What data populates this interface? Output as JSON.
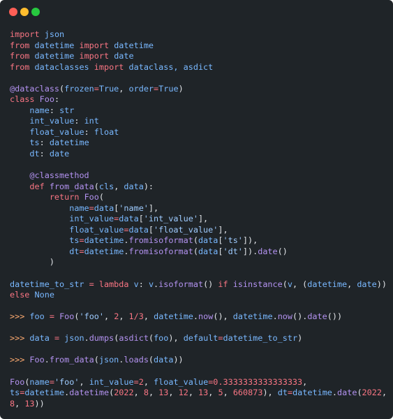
{
  "window": {
    "buttons": [
      "close",
      "minimize",
      "maximize"
    ],
    "colors": {
      "close": "#ff5f56",
      "minimize": "#ffbd2e",
      "maximize": "#27c93f",
      "background": "#1f2428"
    }
  },
  "code_lines": [
    [
      [
        "kw",
        "import"
      ],
      [
        "plain",
        " "
      ],
      [
        "mod",
        "json"
      ]
    ],
    [
      [
        "kw",
        "from"
      ],
      [
        "plain",
        " "
      ],
      [
        "mod",
        "datetime"
      ],
      [
        "plain",
        " "
      ],
      [
        "kw",
        "import"
      ],
      [
        "plain",
        " "
      ],
      [
        "mod",
        "datetime"
      ]
    ],
    [
      [
        "kw",
        "from"
      ],
      [
        "plain",
        " "
      ],
      [
        "mod",
        "datetime"
      ],
      [
        "plain",
        " "
      ],
      [
        "kw",
        "import"
      ],
      [
        "plain",
        " "
      ],
      [
        "mod",
        "date"
      ]
    ],
    [
      [
        "kw",
        "from"
      ],
      [
        "plain",
        " "
      ],
      [
        "mod",
        "dataclasses"
      ],
      [
        "plain",
        " "
      ],
      [
        "kw",
        "import"
      ],
      [
        "plain",
        " "
      ],
      [
        "mod",
        "dataclass, asdict"
      ]
    ],
    [],
    [
      [
        "fn",
        "@dataclass"
      ],
      [
        "plain",
        "("
      ],
      [
        "mod",
        "frozen"
      ],
      [
        "kw",
        "="
      ],
      [
        "mod",
        "True"
      ],
      [
        "plain",
        ", "
      ],
      [
        "mod",
        "order"
      ],
      [
        "kw",
        "="
      ],
      [
        "mod",
        "True"
      ],
      [
        "plain",
        ")"
      ]
    ],
    [
      [
        "kw",
        "class"
      ],
      [
        "plain",
        " "
      ],
      [
        "cls",
        "Foo"
      ],
      [
        "plain",
        ":"
      ]
    ],
    [
      [
        "plain",
        "    "
      ],
      [
        "mod",
        "name"
      ],
      [
        "plain",
        ": "
      ],
      [
        "mod",
        "str"
      ]
    ],
    [
      [
        "plain",
        "    "
      ],
      [
        "mod",
        "int_value"
      ],
      [
        "plain",
        ": "
      ],
      [
        "mod",
        "int"
      ]
    ],
    [
      [
        "plain",
        "    "
      ],
      [
        "mod",
        "float_value"
      ],
      [
        "plain",
        ": "
      ],
      [
        "mod",
        "float"
      ]
    ],
    [
      [
        "plain",
        "    "
      ],
      [
        "mod",
        "ts"
      ],
      [
        "plain",
        ": "
      ],
      [
        "mod",
        "datetime"
      ]
    ],
    [
      [
        "plain",
        "    "
      ],
      [
        "mod",
        "dt"
      ],
      [
        "plain",
        ": "
      ],
      [
        "mod",
        "date"
      ]
    ],
    [],
    [
      [
        "plain",
        "    "
      ],
      [
        "fn",
        "@classmethod"
      ]
    ],
    [
      [
        "plain",
        "    "
      ],
      [
        "kw",
        "def"
      ],
      [
        "plain",
        " "
      ],
      [
        "fn",
        "from_data"
      ],
      [
        "plain",
        "("
      ],
      [
        "mod",
        "cls"
      ],
      [
        "plain",
        ", "
      ],
      [
        "mod",
        "data"
      ],
      [
        "plain",
        "):"
      ]
    ],
    [
      [
        "plain",
        "        "
      ],
      [
        "kw",
        "return"
      ],
      [
        "plain",
        " "
      ],
      [
        "cls",
        "Foo"
      ],
      [
        "plain",
        "("
      ]
    ],
    [
      [
        "plain",
        "            "
      ],
      [
        "mod",
        "name"
      ],
      [
        "kw",
        "="
      ],
      [
        "mod",
        "data"
      ],
      [
        "plain",
        "["
      ],
      [
        "str",
        "'name'"
      ],
      [
        "plain",
        "],"
      ]
    ],
    [
      [
        "plain",
        "            "
      ],
      [
        "mod",
        "int_value"
      ],
      [
        "kw",
        "="
      ],
      [
        "mod",
        "data"
      ],
      [
        "plain",
        "["
      ],
      [
        "str",
        "'int_value'"
      ],
      [
        "plain",
        "],"
      ]
    ],
    [
      [
        "plain",
        "            "
      ],
      [
        "mod",
        "float_value"
      ],
      [
        "kw",
        "="
      ],
      [
        "mod",
        "data"
      ],
      [
        "plain",
        "["
      ],
      [
        "str",
        "'float_value'"
      ],
      [
        "plain",
        "],"
      ]
    ],
    [
      [
        "plain",
        "            "
      ],
      [
        "mod",
        "ts"
      ],
      [
        "kw",
        "="
      ],
      [
        "mod",
        "datetime"
      ],
      [
        "plain",
        "."
      ],
      [
        "fn",
        "fromisoformat"
      ],
      [
        "plain",
        "("
      ],
      [
        "mod",
        "data"
      ],
      [
        "plain",
        "["
      ],
      [
        "str",
        "'ts'"
      ],
      [
        "plain",
        "]),"
      ]
    ],
    [
      [
        "plain",
        "            "
      ],
      [
        "mod",
        "dt"
      ],
      [
        "kw",
        "="
      ],
      [
        "mod",
        "datetime"
      ],
      [
        "plain",
        "."
      ],
      [
        "fn",
        "fromisoformat"
      ],
      [
        "plain",
        "("
      ],
      [
        "mod",
        "data"
      ],
      [
        "plain",
        "["
      ],
      [
        "str",
        "'dt'"
      ],
      [
        "plain",
        "])."
      ],
      [
        "fn",
        "date"
      ],
      [
        "plain",
        "()"
      ]
    ],
    [
      [
        "plain",
        "        )"
      ]
    ],
    [],
    [
      [
        "mod",
        "datetime_to_str"
      ],
      [
        "plain",
        " "
      ],
      [
        "kw",
        "="
      ],
      [
        "plain",
        " "
      ],
      [
        "kw",
        "lambda"
      ],
      [
        "plain",
        " "
      ],
      [
        "mod",
        "v"
      ],
      [
        "plain",
        ": "
      ],
      [
        "mod",
        "v"
      ],
      [
        "plain",
        "."
      ],
      [
        "fn",
        "isoformat"
      ],
      [
        "plain",
        "() "
      ],
      [
        "kw",
        "if"
      ],
      [
        "plain",
        " "
      ],
      [
        "fn",
        "isinstance"
      ],
      [
        "plain",
        "("
      ],
      [
        "mod",
        "v"
      ],
      [
        "plain",
        ", ("
      ],
      [
        "mod",
        "datetime"
      ],
      [
        "plain",
        ", "
      ],
      [
        "mod",
        "date"
      ],
      [
        "plain",
        "))"
      ]
    ],
    [
      [
        "kw",
        "else"
      ],
      [
        "plain",
        " "
      ],
      [
        "mod",
        "None"
      ]
    ],
    [],
    [
      [
        "prompt",
        ">>>"
      ],
      [
        "plain",
        " "
      ],
      [
        "mod",
        "foo"
      ],
      [
        "plain",
        " "
      ],
      [
        "kw",
        "="
      ],
      [
        "plain",
        " "
      ],
      [
        "cls",
        "Foo"
      ],
      [
        "plain",
        "("
      ],
      [
        "str",
        "'foo'"
      ],
      [
        "plain",
        ", "
      ],
      [
        "num",
        "2"
      ],
      [
        "plain",
        ", "
      ],
      [
        "num",
        "1"
      ],
      [
        "kw",
        "/"
      ],
      [
        "num",
        "3"
      ],
      [
        "plain",
        ", "
      ],
      [
        "mod",
        "datetime"
      ],
      [
        "plain",
        "."
      ],
      [
        "fn",
        "now"
      ],
      [
        "plain",
        "(), "
      ],
      [
        "mod",
        "datetime"
      ],
      [
        "plain",
        "."
      ],
      [
        "fn",
        "now"
      ],
      [
        "plain",
        "()."
      ],
      [
        "fn",
        "date"
      ],
      [
        "plain",
        "())"
      ]
    ],
    [],
    [
      [
        "prompt",
        ">>>"
      ],
      [
        "plain",
        " "
      ],
      [
        "mod",
        "data"
      ],
      [
        "plain",
        " "
      ],
      [
        "kw",
        "="
      ],
      [
        "plain",
        " "
      ],
      [
        "mod",
        "json"
      ],
      [
        "plain",
        "."
      ],
      [
        "fn",
        "dumps"
      ],
      [
        "plain",
        "("
      ],
      [
        "fn",
        "asdict"
      ],
      [
        "plain",
        "("
      ],
      [
        "mod",
        "foo"
      ],
      [
        "plain",
        "), "
      ],
      [
        "mod",
        "default"
      ],
      [
        "kw",
        "="
      ],
      [
        "mod",
        "datetime_to_str"
      ],
      [
        "plain",
        ")"
      ]
    ],
    [],
    [
      [
        "prompt",
        ">>>"
      ],
      [
        "plain",
        " "
      ],
      [
        "cls",
        "Foo"
      ],
      [
        "plain",
        "."
      ],
      [
        "fn",
        "from_data"
      ],
      [
        "plain",
        "("
      ],
      [
        "mod",
        "json"
      ],
      [
        "plain",
        "."
      ],
      [
        "fn",
        "loads"
      ],
      [
        "plain",
        "("
      ],
      [
        "mod",
        "data"
      ],
      [
        "plain",
        "))"
      ]
    ],
    [],
    [
      [
        "cls",
        "Foo"
      ],
      [
        "plain",
        "("
      ],
      [
        "mod",
        "name"
      ],
      [
        "kw",
        "="
      ],
      [
        "str",
        "'foo'"
      ],
      [
        "plain",
        ", "
      ],
      [
        "mod",
        "int_value"
      ],
      [
        "kw",
        "="
      ],
      [
        "num",
        "2"
      ],
      [
        "plain",
        ", "
      ],
      [
        "mod",
        "float_value"
      ],
      [
        "kw",
        "="
      ],
      [
        "num",
        "0.3333333333333333"
      ],
      [
        "plain",
        ","
      ]
    ],
    [
      [
        "mod",
        "ts"
      ],
      [
        "kw",
        "="
      ],
      [
        "mod",
        "datetime"
      ],
      [
        "plain",
        "."
      ],
      [
        "fn",
        "datetime"
      ],
      [
        "plain",
        "("
      ],
      [
        "num",
        "2022"
      ],
      [
        "plain",
        ", "
      ],
      [
        "num",
        "8"
      ],
      [
        "plain",
        ", "
      ],
      [
        "num",
        "13"
      ],
      [
        "plain",
        ", "
      ],
      [
        "num",
        "12"
      ],
      [
        "plain",
        ", "
      ],
      [
        "num",
        "13"
      ],
      [
        "plain",
        ", "
      ],
      [
        "num",
        "5"
      ],
      [
        "plain",
        ", "
      ],
      [
        "num",
        "660873"
      ],
      [
        "plain",
        "), "
      ],
      [
        "mod",
        "dt"
      ],
      [
        "kw",
        "="
      ],
      [
        "mod",
        "datetime"
      ],
      [
        "plain",
        "."
      ],
      [
        "fn",
        "date"
      ],
      [
        "plain",
        "("
      ],
      [
        "num",
        "2022"
      ],
      [
        "plain",
        ","
      ]
    ],
    [
      [
        "num",
        "8"
      ],
      [
        "plain",
        ", "
      ],
      [
        "num",
        "13"
      ],
      [
        "plain",
        "))"
      ]
    ]
  ]
}
